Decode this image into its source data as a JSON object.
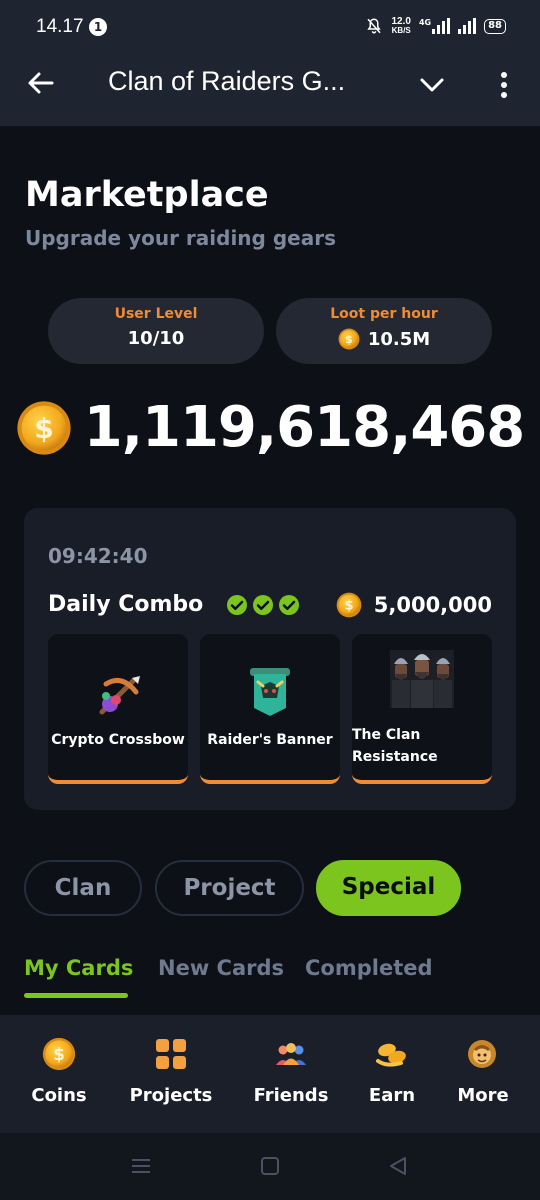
{
  "status": {
    "time": "14.17",
    "notif_count": "1",
    "net_speed_value": "12.0",
    "net_speed_unit": "KB/S",
    "net_type": "4G",
    "battery": "88"
  },
  "appbar": {
    "title": "Clan of Raiders G..."
  },
  "header": {
    "title": "Marketplace",
    "subtitle": "Upgrade your raiding gears"
  },
  "stats": {
    "user_level_label": "User Level",
    "user_level_value": "10/10",
    "loot_label": "Loot per hour",
    "loot_value": "10.5M"
  },
  "balance": "1,119,618,468",
  "combo": {
    "timer": "09:42:40",
    "title": "Daily Combo",
    "reward": "5,000,000",
    "cards": [
      {
        "name": "Crypto Crossbow",
        "icon": "crossbow-icon"
      },
      {
        "name": "Raider's Banner",
        "icon": "banner-icon"
      },
      {
        "name": "The Clan Resistance",
        "icon": "warriors-image"
      }
    ]
  },
  "category_tabs": [
    "Clan",
    "Project",
    "Special"
  ],
  "card_tabs": [
    "My Cards",
    "New Cards",
    "Completed"
  ],
  "bottom_nav": [
    {
      "label": "Coins",
      "icon": "coin-icon"
    },
    {
      "label": "Projects",
      "icon": "grid-icon"
    },
    {
      "label": "Friends",
      "icon": "friends-icon"
    },
    {
      "label": "Earn",
      "icon": "earn-icon"
    },
    {
      "label": "More",
      "icon": "more-icon"
    }
  ],
  "colors": {
    "accent_green": "#7cc41e",
    "accent_orange": "#f08c35",
    "coin_gold": "#f2a81d"
  }
}
